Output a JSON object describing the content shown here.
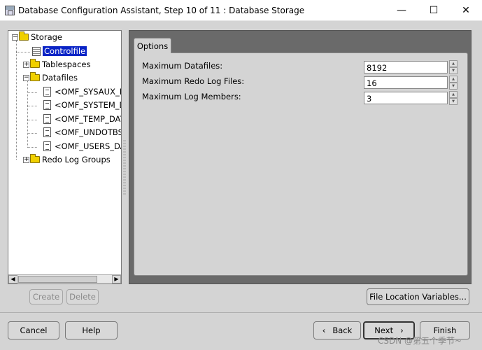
{
  "window": {
    "title": "Database Configuration Assistant, Step 10 of 11 : Database Storage",
    "minimize": "—",
    "maximize": "☐",
    "close": "✕"
  },
  "tree": {
    "storage": "Storage",
    "controlfile": "Controlfile",
    "tablespaces": "Tablespaces",
    "datafiles": "Datafiles",
    "datafile_items": [
      "<OMF_SYSAUX_DA",
      "<OMF_SYSTEM_D",
      "<OMF_TEMP_DAT",
      "<OMF_UNDOTBS:",
      "<OMF_USERS_DAT"
    ],
    "redo": "Redo Log Groups"
  },
  "options": {
    "tab": "Options",
    "max_datafiles_label": "Maximum Datafiles:",
    "max_datafiles_value": "8192",
    "max_redo_label": "Maximum Redo Log Files:",
    "max_redo_value": "16",
    "max_members_label": "Maximum Log Members:",
    "max_members_value": "3"
  },
  "buttons": {
    "create": "Create",
    "delete": "Delete",
    "file_location": "File Location Variables...",
    "cancel": "Cancel",
    "help": "Help",
    "back": "Back",
    "next": "Next",
    "finish": "Finish"
  },
  "watermark": "CSDN @第五个季节~"
}
